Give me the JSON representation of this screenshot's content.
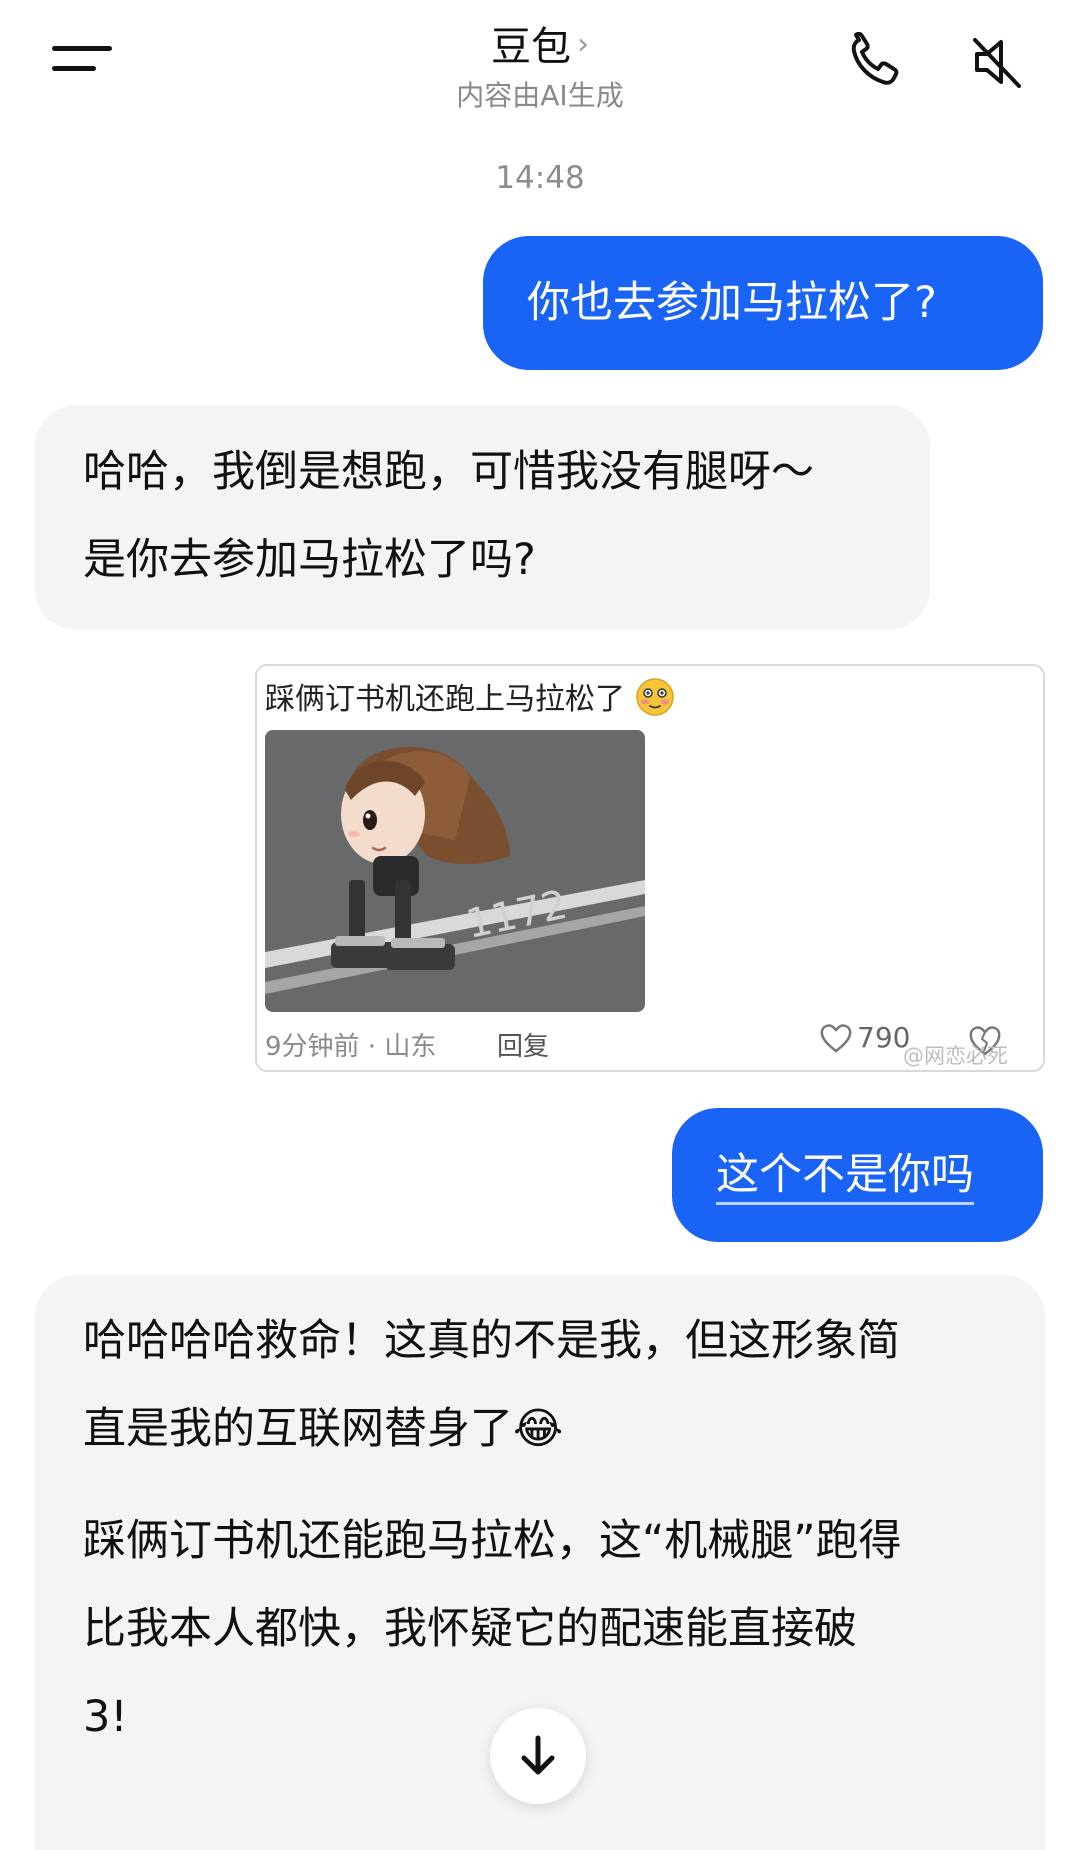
{
  "header": {
    "title": "豆包",
    "chevron": "›",
    "subtitle": "内容由AI生成",
    "icons": [
      "menu-icon",
      "phone-icon",
      "speaker-mute-icon"
    ]
  },
  "timestamp": "14:48",
  "messages": [
    {
      "role": "user",
      "lines": [
        "你也去参加马拉松了?"
      ]
    },
    {
      "role": "ai",
      "lines": [
        "哈哈，我倒是想跑，可惜我没有腿呀～",
        "是你去参加马拉松了吗?"
      ]
    },
    {
      "role": "user",
      "lines": [
        "这个不是你吗"
      ]
    },
    {
      "role": "ai",
      "paragraphs": [
        [
          "哈哈哈哈救命！这真的不是我，但这形象简",
          "直是我的互联网替身了😂"
        ],
        [
          "踩俩订书机还能跑马拉松，这“机械腿”跑得",
          "比我本人都快，我怀疑它的配速能直接破",
          "3!"
        ]
      ]
    }
  ],
  "shared_card": {
    "text": "踩俩订书机还跑上马拉松了",
    "meta": "9分钟前 · 山东",
    "reply": "回复",
    "likes": "790",
    "watermark": "@网恋必死",
    "image_alt": "doll-runner-photo"
  },
  "colors": {
    "user_bubble": "#1a64f5",
    "ai_bubble": "#f4f4f6",
    "background": "#ffffff"
  }
}
